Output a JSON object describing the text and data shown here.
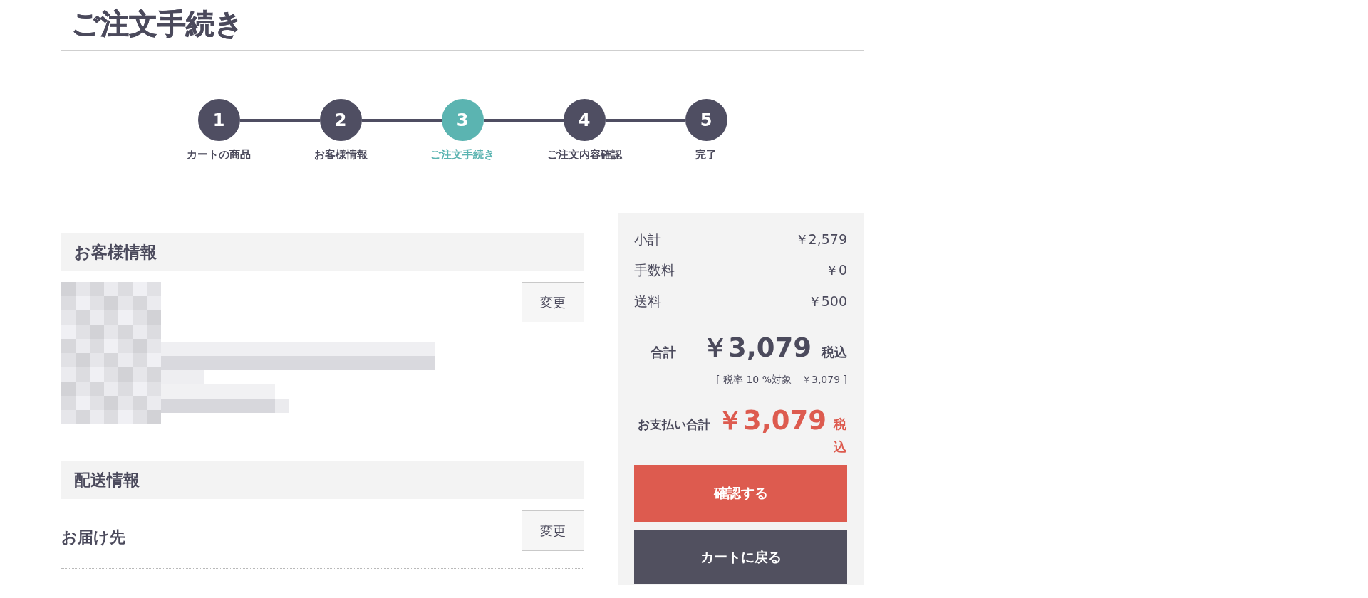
{
  "page": {
    "title": "ご注文手続き"
  },
  "steps": [
    {
      "number": "1",
      "label": "カートの商品",
      "selected": false
    },
    {
      "number": "2",
      "label": "お客様情報",
      "selected": false
    },
    {
      "number": "3",
      "label": "ご注文手続き",
      "selected": true
    },
    {
      "number": "4",
      "label": "ご注文内容確認",
      "selected": false
    },
    {
      "number": "5",
      "label": "完了",
      "selected": false
    }
  ],
  "customer_section": {
    "heading": "お客様情報",
    "change_button": "変更"
  },
  "shipping_section": {
    "heading": "配送情報",
    "label": "お届け先",
    "change_button": "変更"
  },
  "summary": {
    "rows": [
      {
        "label": "小計",
        "value": "￥2,579"
      },
      {
        "label": "手数料",
        "value": "￥0"
      },
      {
        "label": "送料",
        "value": "￥500"
      }
    ],
    "total": {
      "label": "合計",
      "amount": "￥3,079",
      "tax_suffix": "税込"
    },
    "tax_note": "[ 税率 10 %対象　￥3,079 ]",
    "payment_total": {
      "label": "お支払い合計",
      "amount": "￥3,079",
      "tax_suffix": "税込"
    },
    "buttons": [
      {
        "label": "確認する",
        "kind": "primary"
      },
      {
        "label": "カートに戻る",
        "kind": "secondary"
      }
    ]
  }
}
